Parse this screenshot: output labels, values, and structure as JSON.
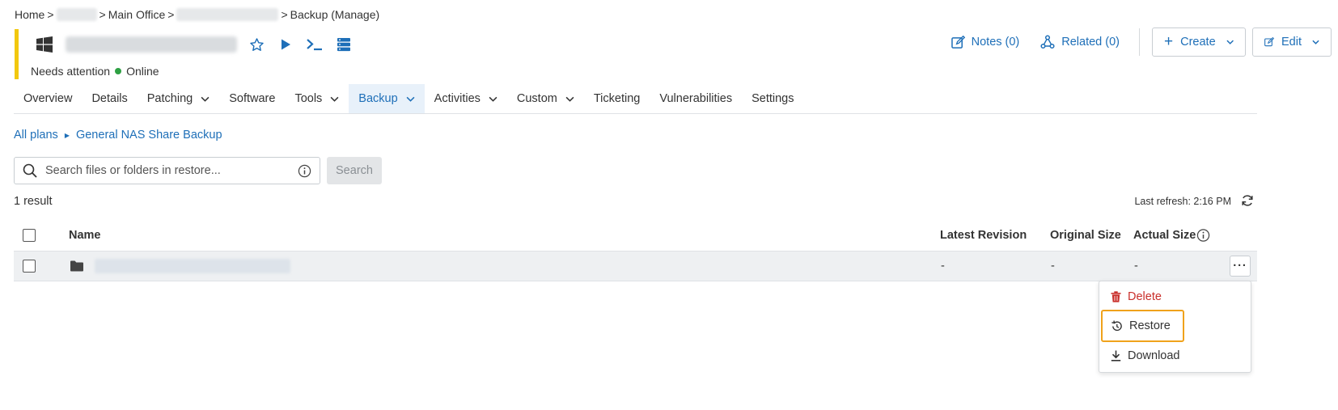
{
  "breadcrumb": {
    "home": "Home",
    "office": "Main Office",
    "current": "Backup (Manage)",
    "sep": ">"
  },
  "device": {
    "status_text": "Needs attention",
    "online_text": "Online"
  },
  "actions": {
    "notes": "Notes (0)",
    "related": "Related (0)",
    "create": "Create",
    "edit": "Edit"
  },
  "tabs": [
    {
      "label": "Overview",
      "dropdown": false
    },
    {
      "label": "Details",
      "dropdown": false
    },
    {
      "label": "Patching",
      "dropdown": true
    },
    {
      "label": "Software",
      "dropdown": false
    },
    {
      "label": "Tools",
      "dropdown": true
    },
    {
      "label": "Backup",
      "dropdown": true,
      "active": true
    },
    {
      "label": "Activities",
      "dropdown": true
    },
    {
      "label": "Custom",
      "dropdown": true
    },
    {
      "label": "Ticketing",
      "dropdown": false
    },
    {
      "label": "Vulnerabilities",
      "dropdown": false
    },
    {
      "label": "Settings",
      "dropdown": false
    }
  ],
  "plan_breadcrumb": {
    "all_plans": "All plans",
    "plan": "General NAS Share Backup"
  },
  "search": {
    "placeholder": "Search files or folders in restore...",
    "value": "",
    "button": "Search"
  },
  "results": {
    "count": "1 result",
    "last_refresh": "Last refresh: 2:16 PM"
  },
  "table": {
    "columns": {
      "name": "Name",
      "latest_revision": "Latest Revision",
      "original_size": "Original Size",
      "actual_size": "Actual Size"
    },
    "rows": [
      {
        "latest_revision": "-",
        "original_size": "-",
        "actual_size": "-"
      }
    ],
    "more": "···"
  },
  "context_menu": {
    "delete": "Delete",
    "restore": "Restore",
    "download": "Download"
  },
  "colors": {
    "accent": "#1e6fb8",
    "status_bar": "#f2c80f",
    "danger": "#c9302c",
    "highlight": "#f0a21b",
    "online": "#2ea043"
  }
}
